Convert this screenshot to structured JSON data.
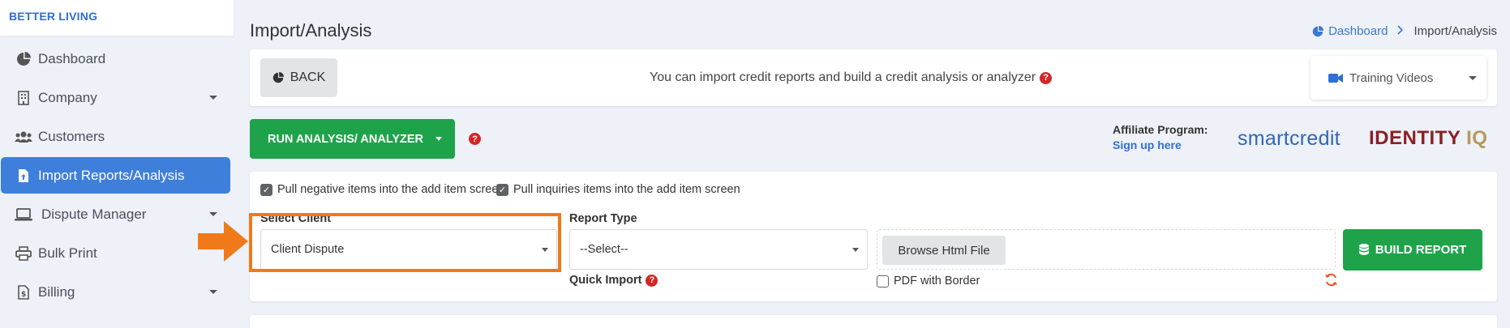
{
  "brand": "BETTER LIVING",
  "sidebar": {
    "items": [
      {
        "label": "Dashboard",
        "icon": "pie-chart-icon"
      },
      {
        "label": "Company",
        "icon": "building-icon"
      },
      {
        "label": "Customers",
        "icon": "users-icon"
      },
      {
        "label": "Import Reports/Analysis",
        "icon": "file-upload-icon"
      },
      {
        "label": "Dispute Manager",
        "icon": "laptop-icon"
      },
      {
        "label": "Bulk Print",
        "icon": "printer-icon"
      },
      {
        "label": "Billing",
        "icon": "invoice-icon"
      }
    ]
  },
  "header": {
    "title": "Import/Analysis",
    "breadcrumb_home": "Dashboard",
    "breadcrumb_current": "Import/Analysis"
  },
  "toolbar": {
    "back_label": "BACK",
    "info_text": "You can import credit reports and build a credit analysis or analyzer",
    "training_label": "Training Videos"
  },
  "actions": {
    "run_label": "RUN ANALYSIS/ ANALYZER",
    "affiliate_label": "Affiliate Program:",
    "affiliate_link": "Sign up here",
    "logo_smartcredit": "smartcredit",
    "logo_identity": "IDENTITY",
    "logo_iq": "IQ"
  },
  "form": {
    "check_negative": "Pull negative items into the add item screen",
    "check_inquiries": "Pull inquiries items into the add item screen",
    "select_client_label": "Select Client",
    "select_client_value": "Client Dispute",
    "report_type_label": "Report Type",
    "report_type_value": "--Select--",
    "browse_label": "Browse Html File",
    "build_label": "BUILD REPORT",
    "quick_import_label": "Quick Import",
    "pdf_border_label": "PDF with Border"
  },
  "colors": {
    "accent": "#3e7fdc",
    "success": "#1fa34a",
    "help": "#d52626",
    "highlight": "#f07a1a"
  }
}
